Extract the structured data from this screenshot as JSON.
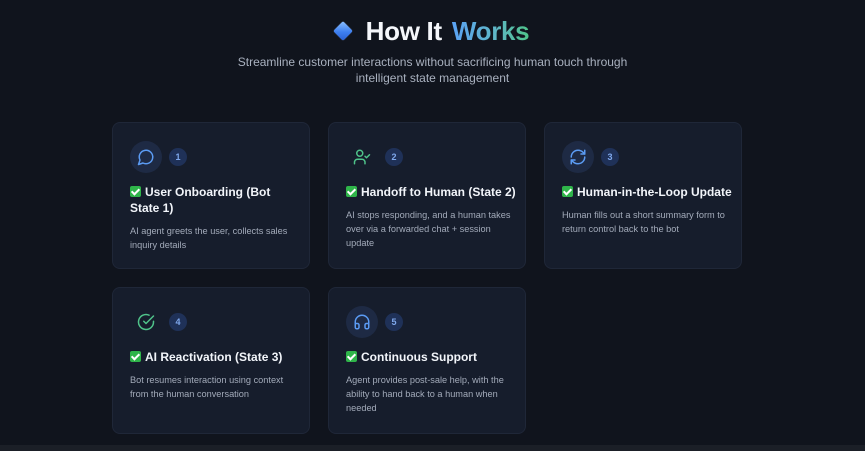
{
  "header": {
    "title_part1": "How It",
    "title_part2": "Works",
    "subtitle": "Streamline customer interactions without sacrificing human touch through intelligent state management"
  },
  "colors": {
    "background": "#10141d",
    "card_background": "#161d2c",
    "accent_blue": "#5aa2f5",
    "accent_green": "#4fc38a",
    "check_green": "#2fb54a"
  },
  "steps": [
    {
      "number": "1",
      "icon": "chat-bubble-icon",
      "title": "User Onboarding (Bot State 1)",
      "description": "AI agent greets the user, collects sales inquiry details"
    },
    {
      "number": "2",
      "icon": "user-check-icon",
      "title": "Handoff to Human (State 2)",
      "description": "AI stops responding, and a human takes over via a forwarded chat + session update"
    },
    {
      "number": "3",
      "icon": "refresh-icon",
      "title": "Human-in-the-Loop Update",
      "description": "Human fills out a short summary form to return control back to the bot"
    },
    {
      "number": "4",
      "icon": "check-circle-icon",
      "title": "AI Reactivation (State 3)",
      "description": "Bot resumes interaction using context from the human conversation"
    },
    {
      "number": "5",
      "icon": "headphones-icon",
      "title": "Continuous Support",
      "description": "Agent provides post-sale help, with the ability to hand back to a human when needed"
    }
  ]
}
